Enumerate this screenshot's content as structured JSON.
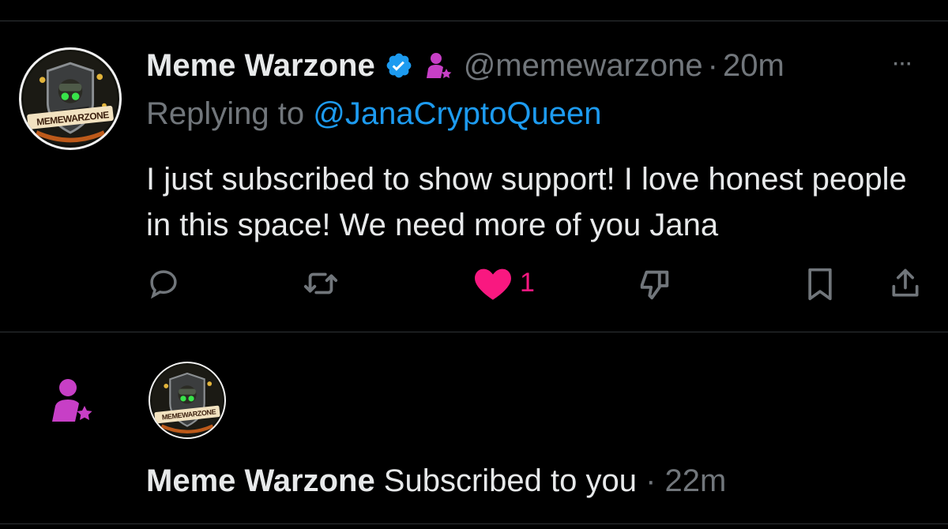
{
  "reply": {
    "display_name": "Meme Warzone",
    "handle": "@memewarzone",
    "separator": "·",
    "time": "20m",
    "more_label": "···",
    "replying_prefix": "Replying to ",
    "replying_to": "@JanaCryptoQueen",
    "text": "I just subscribed to show support! I love honest people in this space! We need more of you Jana",
    "avatar_text": "MEMEWARZONE",
    "actions": {
      "reply_icon": "reply-icon",
      "retweet_icon": "retweet-icon",
      "like_icon": "heart-filled-icon",
      "like_count": "1",
      "dislike_icon": "thumbs-down-icon",
      "bookmark_icon": "bookmark-icon",
      "share_icon": "share-icon"
    }
  },
  "notification": {
    "icon": "subscriber-star-icon",
    "avatar_text": "MEMEWARZONE",
    "display_name": "Meme Warzone",
    "message": " Subscribed to you",
    "separator": " · ",
    "time": "22m"
  },
  "colors": {
    "background": "#000000",
    "text": "#e7e9ea",
    "muted": "#71767b",
    "link": "#1d9bf0",
    "like": "#f91880",
    "verified": "#1d9bf0",
    "subscriber": "#c73fc6",
    "divider": "#2f3336"
  }
}
